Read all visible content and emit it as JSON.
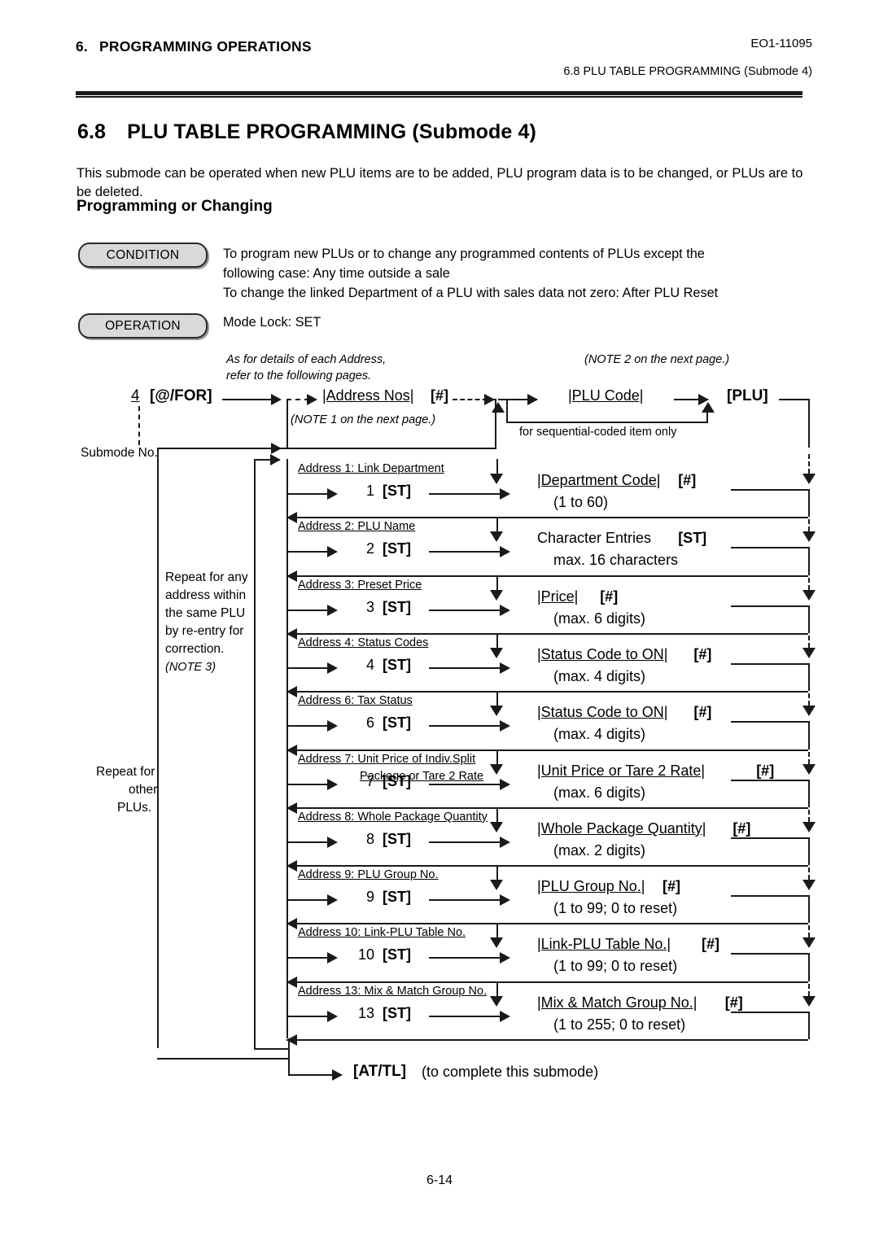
{
  "header": {
    "chapter_number": "6.",
    "chapter_title": "PROGRAMMING OPERATIONS",
    "doc_code": "EO1-11095",
    "running_head": "6.8  PLU TABLE PROGRAMMING  (Submode 4)"
  },
  "section": {
    "number": "6.8",
    "title": "PLU TABLE PROGRAMMING  (Submode 4)",
    "intro": "This submode can be operated when new PLU items are to be added, PLU program data is to be changed, or PLUs are to be deleted.",
    "subtitle": "Programming or Changing"
  },
  "condition": {
    "pill_label": "CONDITION",
    "line1": "To program new PLUs or to change any programmed contents of PLUs except the",
    "line2": "following case:  Any time outside a sale",
    "line3": "To change the linked Department of a PLU with sales data not zero:  After PLU Reset"
  },
  "operation": {
    "pill_label": "OPERATION",
    "text": "Mode Lock:  SET"
  },
  "flow": {
    "note_address_l1": "As for details of each Address,",
    "note_address_l2": "refer to the following pages.",
    "note2": "(NOTE 2 on the next page.)",
    "note1": "(NOTE 1 on the next page.)",
    "submode_key_num": "4",
    "submode_key": "[@/FOR]",
    "submode_caption": "Submode No.",
    "address_nos": "|Address Nos|",
    "hash_key": "[#]",
    "plu_code": "|PLU Code|",
    "plu_key": "[PLU]",
    "sequential_note": "for sequential-coded item only",
    "repeat_address_l1": "Repeat for any",
    "repeat_address_l2": "address within",
    "repeat_address_l3": "the same PLU",
    "repeat_address_l4": "by re-entry for",
    "repeat_address_l5": "correction.",
    "repeat_address_note": "(NOTE 3)",
    "repeat_plu_l1": "Repeat for",
    "repeat_plu_l2": "other",
    "repeat_plu_l3": "PLUs.",
    "finish_key": "[AT/TL]",
    "finish_caption": "(to complete this submode)"
  },
  "rows": [
    {
      "address_label": "Address 1:  Link Department",
      "address_label2": "",
      "st_num": "1",
      "st_key": "[ST]",
      "entry": "|Department Code|",
      "entry_key": "[#]",
      "entry_range": "(1 to 60)"
    },
    {
      "address_label": "Address 2:  PLU Name",
      "address_label2": "",
      "st_num": "2",
      "st_key": "[ST]",
      "entry": "Character Entries",
      "entry_key": "[ST]",
      "entry_range": "max. 16 characters"
    },
    {
      "address_label": "Address 3:  Preset Price",
      "address_label2": "",
      "st_num": "3",
      "st_key": "[ST]",
      "entry": "|Price|",
      "entry_key": "[#]",
      "entry_range": "(max. 6 digits)"
    },
    {
      "address_label": "Address 4:  Status Codes",
      "address_label2": "",
      "st_num": "4",
      "st_key": "[ST]",
      "entry": "|Status Code to ON|",
      "entry_key": "[#]",
      "entry_range": "(max. 4 digits)"
    },
    {
      "address_label": "Address 6:  Tax Status",
      "address_label2": "",
      "st_num": "6",
      "st_key": "[ST]",
      "entry": "|Status Code to ON|",
      "entry_key": "[#]",
      "entry_range": "(max. 4 digits)"
    },
    {
      "address_label": "Address 7:  Unit Price of Indiv.Split",
      "address_label2": "Package or Tare 2 Rate",
      "st_num": "7",
      "st_key": "[ST]",
      "entry": "|Unit Price or Tare 2 Rate|",
      "entry_key": "[#]",
      "entry_range": "(max. 6 digits)"
    },
    {
      "address_label": "Address 8:  Whole Package Quantity",
      "address_label2": "",
      "st_num": "8",
      "st_key": "[ST]",
      "entry": "|Whole Package Quantity|",
      "entry_key": "[#]",
      "entry_range": "(max. 2 digits)"
    },
    {
      "address_label": "Address 9:  PLU Group No.",
      "address_label2": "",
      "st_num": "9",
      "st_key": "[ST]",
      "entry": "|PLU Group No.|",
      "entry_key": "[#]",
      "entry_range": "(1 to 99;  0 to reset)"
    },
    {
      "address_label": "Address 10:  Link-PLU Table No.",
      "address_label2": "",
      "st_num": "10",
      "st_key": "[ST]",
      "entry": "|Link-PLU Table No.|",
      "entry_key": "[#]",
      "entry_range": "(1 to 99;  0 to reset)"
    },
    {
      "address_label": "Address 13:  Mix & Match Group No.",
      "address_label2": "",
      "st_num": "13",
      "st_key": "[ST]",
      "entry": "|Mix & Match Group No.|",
      "entry_key": "[#]",
      "entry_range": "(1 to 255;  0 to reset)"
    }
  ],
  "footer": {
    "page_number": "6-14"
  }
}
